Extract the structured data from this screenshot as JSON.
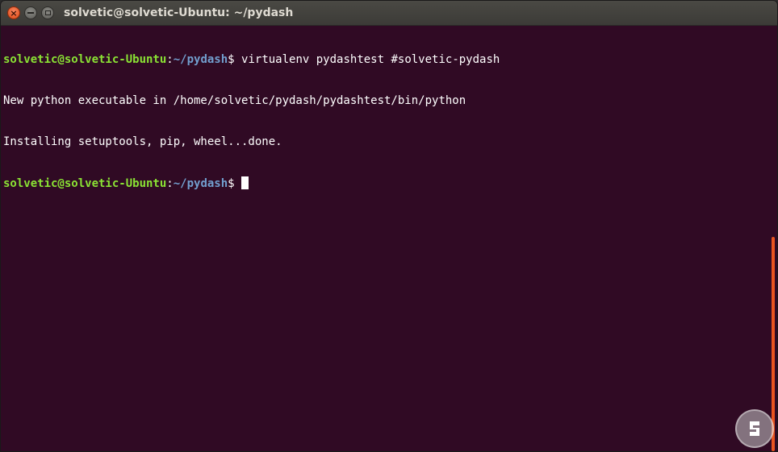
{
  "window": {
    "title": "solvetic@solvetic-Ubuntu: ~/pydash",
    "controls": {
      "close_glyph": "×"
    }
  },
  "terminal": {
    "lines": [
      {
        "prompt_user": "solvetic@solvetic-Ubuntu",
        "prompt_sep": ":",
        "prompt_path": "~/pydash",
        "prompt_symbol": "$ ",
        "command": "virtualenv pydashtest #solvetic-pydash"
      },
      {
        "output": "New python executable in /home/solvetic/pydash/pydashtest/bin/python"
      },
      {
        "output": "Installing setuptools, pip, wheel...done."
      },
      {
        "prompt_user": "solvetic@solvetic-Ubuntu",
        "prompt_sep": ":",
        "prompt_path": "~/pydash",
        "prompt_symbol": "$ ",
        "command": ""
      }
    ]
  },
  "colors": {
    "background": "#300a24",
    "prompt_user": "#8ae234",
    "prompt_path": "#729fcf",
    "text": "#ffffff",
    "scroll_thumb": "#e95420"
  },
  "watermark": {
    "icon": "solvetic-logo-icon"
  }
}
